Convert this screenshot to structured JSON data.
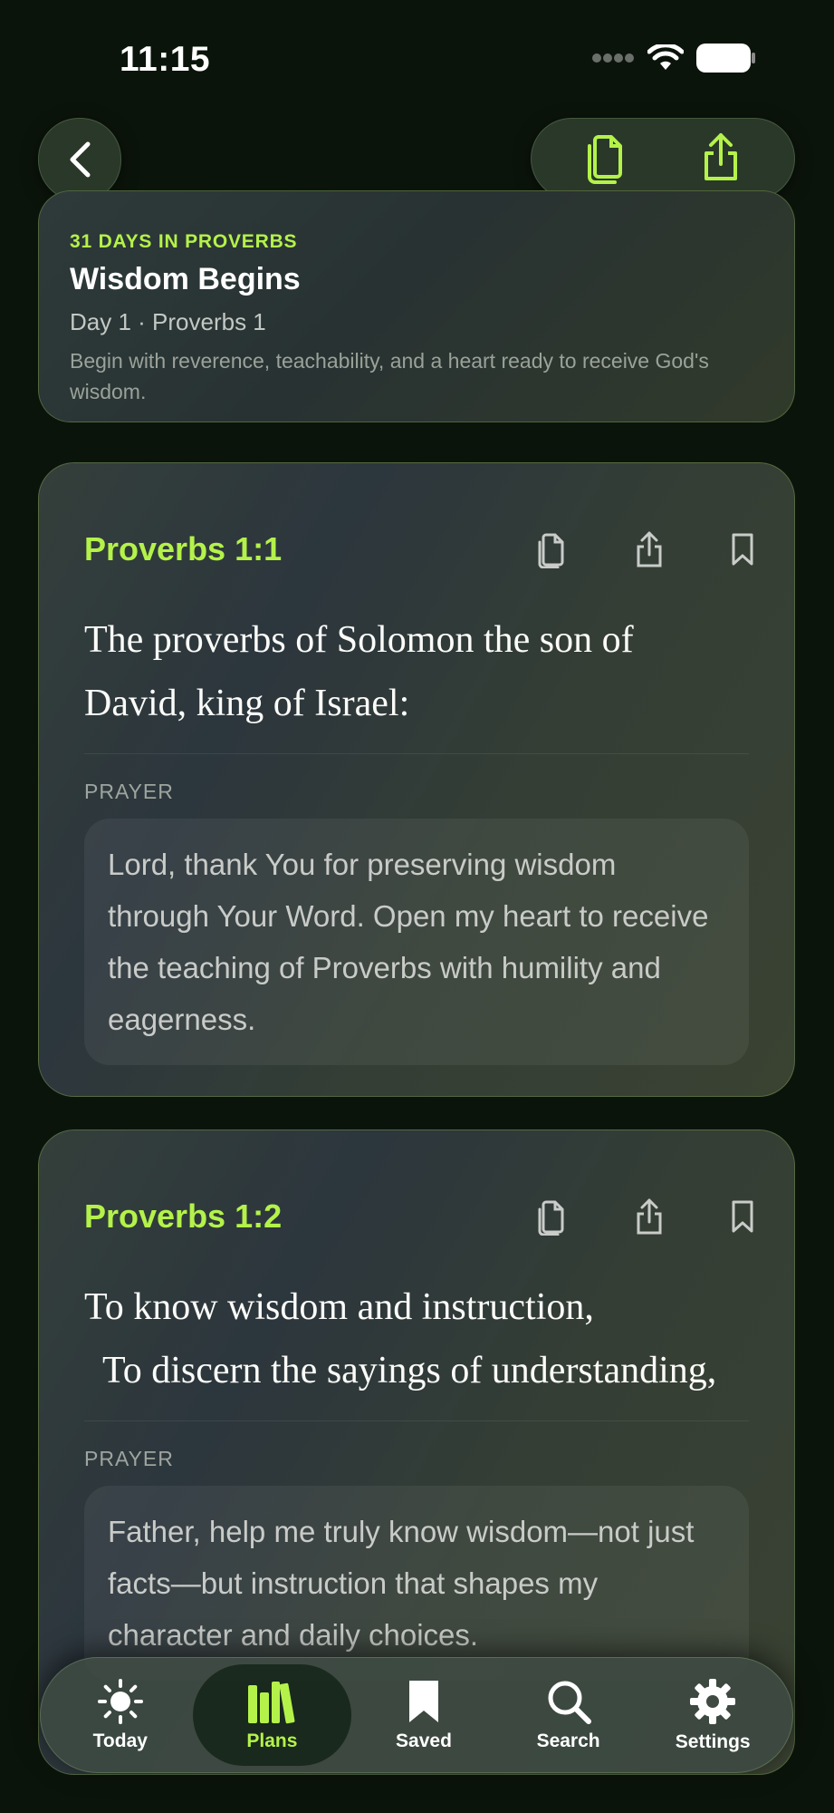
{
  "status": {
    "time": "11:15"
  },
  "header": {
    "back_icon": "chevron-left-icon",
    "actions": [
      "copy-icon",
      "share-icon"
    ]
  },
  "plan": {
    "kicker": "31 DAYS IN PROVERBS",
    "title": "Wisdom Begins",
    "subtitle": "Day 1 · Proverbs 1",
    "description": "Begin with reverence, teachability, and a heart ready to receive God's wisdom."
  },
  "verses": [
    {
      "reference": "Proverbs 1:1",
      "text": "The proverbs of Solomon the son of David, king of Israel:",
      "prayer_label": "PRAYER",
      "prayer": "Lord, thank You for preserving wisdom through Your Word. Open my heart to receive the teaching of Proverbs with humility and eagerness."
    },
    {
      "reference": "Proverbs 1:2",
      "text_line1": "To know wisdom and instruction,",
      "text_line2": "To discern the sayings of understanding,",
      "prayer_label": "PRAYER",
      "prayer": "Father, help me truly know wisdom—not just facts—but instruction that shapes my character and daily choices."
    }
  ],
  "tabs": [
    {
      "label": "Today",
      "icon": "sun-icon"
    },
    {
      "label": "Plans",
      "icon": "books-icon",
      "active": true
    },
    {
      "label": "Saved",
      "icon": "bookmark-icon"
    },
    {
      "label": "Search",
      "icon": "search-icon"
    },
    {
      "label": "Settings",
      "icon": "gear-icon"
    }
  ],
  "colors": {
    "accent": "#b4f24a",
    "background": "#0b140b"
  }
}
